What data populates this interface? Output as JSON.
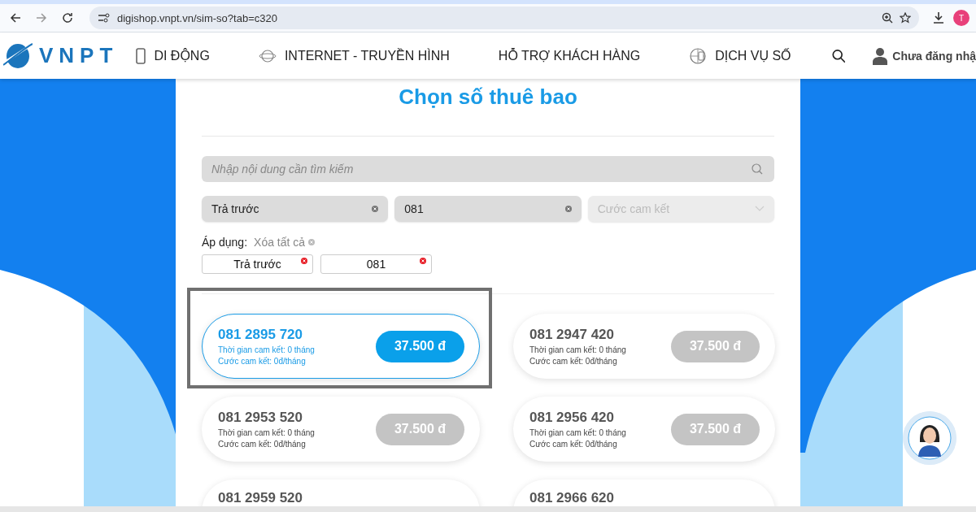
{
  "browser": {
    "url": "digishop.vnpt.vn/sim-so?tab=c320",
    "profile_initial": "T"
  },
  "nav": {
    "logo": "VNPT",
    "items": [
      {
        "label": "DI ĐỘNG",
        "kind": "phone"
      },
      {
        "label": "INTERNET - TRUYỀN HÌNH",
        "kind": "globe"
      },
      {
        "label": "HỖ TRỢ KHÁCH HÀNG",
        "kind": "none"
      },
      {
        "label": "DỊCH VỤ SỐ",
        "kind": "digital"
      }
    ],
    "account": "Chưa đăng nhậ"
  },
  "title": "Chọn số thuê bao",
  "search": {
    "placeholder": "Nhập nội dung cần tìm kiếm"
  },
  "filters": [
    {
      "value": "Trả trước",
      "kind": "clearable"
    },
    {
      "value": "081",
      "kind": "clearable"
    },
    {
      "placeholder": "Cước cam kết",
      "kind": "dropdown"
    }
  ],
  "applied": {
    "label": "Áp dụng:",
    "clear_all": "Xóa tất cả",
    "chips": [
      "Trả trước",
      "081"
    ]
  },
  "numbers": [
    {
      "number": "081 2895 720",
      "term": "Thời gian cam kết: 0 tháng",
      "fee": "Cước cam kết: 0đ/tháng",
      "price": "37.500 đ",
      "selected": true
    },
    {
      "number": "081 2947 420",
      "term": "Thời gian cam kết: 0 tháng",
      "fee": "Cước cam kết: 0đ/tháng",
      "price": "37.500 đ",
      "selected": false
    },
    {
      "number": "081 2953 520",
      "term": "Thời gian cam kết: 0 tháng",
      "fee": "Cước cam kết: 0đ/tháng",
      "price": "37.500 đ",
      "selected": false
    },
    {
      "number": "081 2956 420",
      "term": "Thời gian cam kết: 0 tháng",
      "fee": "Cước cam kết: 0đ/tháng",
      "price": "37.500 đ",
      "selected": false
    },
    {
      "number": "081 2959 520",
      "selected": false
    },
    {
      "number": "081 2966 620",
      "selected": false
    }
  ]
}
